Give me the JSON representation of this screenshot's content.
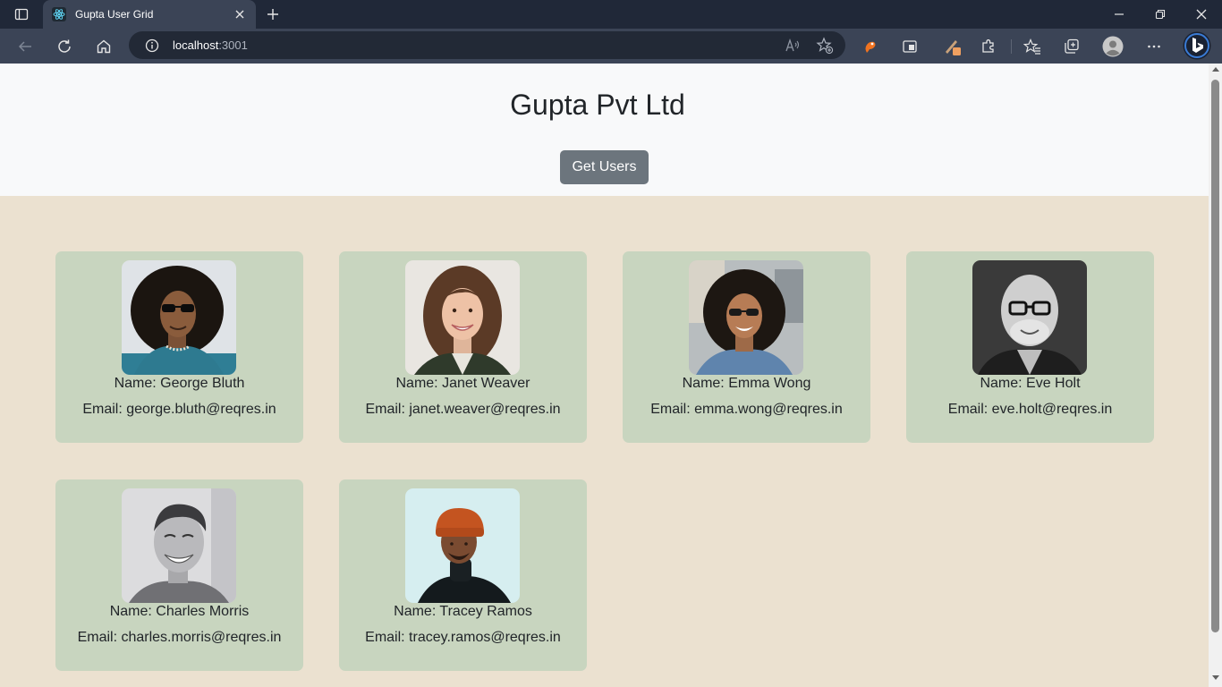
{
  "browser": {
    "tab_title": "Gupta User Grid",
    "url_host": "localhost",
    "url_port": ":3001",
    "icons": {
      "tab_actions": "tab-actions-icon",
      "favicon": "react-icon",
      "close": "close-icon",
      "new_tab": "plus-icon",
      "minimize": "minimize-icon",
      "restore": "restore-icon",
      "window_close": "close-icon",
      "back": "back-arrow-icon",
      "refresh": "refresh-icon",
      "home": "home-icon",
      "site_info": "info-icon",
      "read_aloud": "read-aloud-icon",
      "favorite_add": "star-plus-icon",
      "extensions": "puzzle-icon",
      "favorites": "favorites-icon",
      "collections": "collections-icon",
      "profile": "profile-icon",
      "more": "more-icon",
      "copilot": "bing-icon"
    },
    "colors": {
      "titlebar": "#202838",
      "toolbar": "#3b4456",
      "address_bar": "#222936"
    }
  },
  "page": {
    "title": "Gupta Pvt Ltd",
    "button_label": "Get Users",
    "colors": {
      "header_bg": "#f8f9fa",
      "page_bg": "#ebe1d0",
      "card_bg": "#c8d5bf",
      "button_bg": "#6c757d"
    },
    "users": [
      {
        "name_text": "Name: George Bluth",
        "email_text": "Email: george.bluth@reqres.in"
      },
      {
        "name_text": "Name: Janet Weaver",
        "email_text": "Email: janet.weaver@reqres.in"
      },
      {
        "name_text": "Name: Emma Wong",
        "email_text": "Email: emma.wong@reqres.in"
      },
      {
        "name_text": "Name: Eve Holt",
        "email_text": "Email: eve.holt@reqres.in"
      },
      {
        "name_text": "Name: Charles Morris",
        "email_text": "Email: charles.morris@reqres.in"
      },
      {
        "name_text": "Name: Tracey Ramos",
        "email_text": "Email: tracey.ramos@reqres.in"
      }
    ]
  }
}
